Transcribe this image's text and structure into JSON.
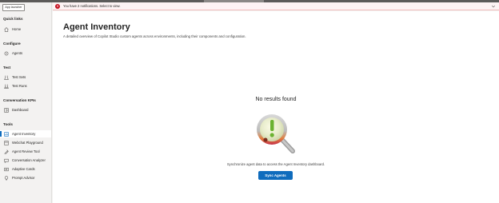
{
  "sidebar": {
    "app_launcher": "App launcher",
    "sections": [
      {
        "title": "Quick links",
        "items": [
          {
            "label": "Home",
            "icon": "home-icon"
          }
        ]
      },
      {
        "title": "Configure",
        "items": [
          {
            "label": "Agents",
            "icon": "agent-icon"
          }
        ]
      },
      {
        "title": "Test",
        "items": [
          {
            "label": "Test Sets",
            "icon": "test-sets-icon"
          },
          {
            "label": "Test Runs",
            "icon": "test-runs-icon"
          }
        ]
      },
      {
        "title": "Conversation KPIs",
        "items": [
          {
            "label": "Dashboard",
            "icon": "dashboard-icon"
          }
        ]
      },
      {
        "title": "Tools",
        "items": [
          {
            "label": "Agent Inventory",
            "icon": "inventory-icon",
            "active": true
          },
          {
            "label": "Webchat Playground",
            "icon": "webchat-icon"
          },
          {
            "label": "Agent Review Tool",
            "icon": "review-icon"
          },
          {
            "label": "Conversation Analyzer",
            "icon": "analyzer-icon"
          },
          {
            "label": "Adaptive Cards",
            "icon": "cards-icon"
          },
          {
            "label": "Prompt Advisor",
            "icon": "prompt-icon"
          }
        ]
      }
    ]
  },
  "notification": {
    "message": "You have 2 notifications. Select to view.",
    "icon": "error-icon"
  },
  "main": {
    "title": "Agent Inventory",
    "description": "A detailed overview of Copilot Studio custom agents across environments, including their components and configuration.",
    "empty_title": "No results found",
    "empty_description": "Synchronize agent data to access the Agent Inventory dashboard.",
    "sync_button": "Sync Agents"
  },
  "colors": {
    "accent": "#0f6cbd",
    "error": "#c50f1f",
    "notification_bg": "#fdf3f4"
  }
}
